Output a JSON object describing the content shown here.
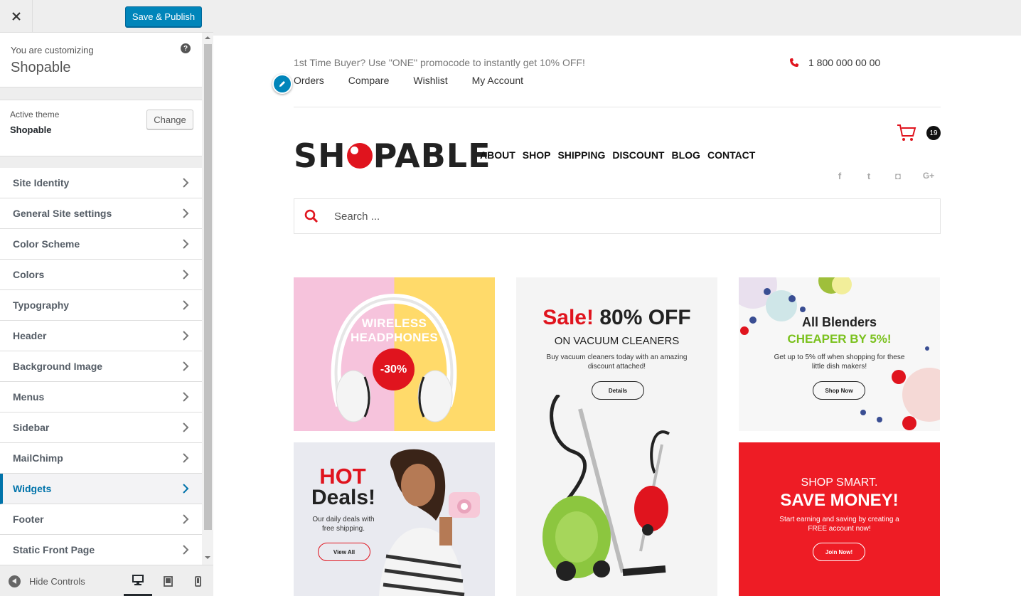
{
  "customizer": {
    "close_icon": "close-icon",
    "publish_label": "Save & Publish",
    "customizing_sub": "You are customizing",
    "site_name": "Shopable",
    "help_icon": "help-icon",
    "help_glyph": "?",
    "active_theme_label": "Active theme",
    "active_theme_name": "Shopable",
    "change_label": "Change",
    "panels": [
      {
        "label": "Site Identity"
      },
      {
        "label": "General Site settings"
      },
      {
        "label": "Color Scheme"
      },
      {
        "label": "Colors"
      },
      {
        "label": "Typography"
      },
      {
        "label": "Header"
      },
      {
        "label": "Background Image"
      },
      {
        "label": "Menus"
      },
      {
        "label": "Sidebar"
      },
      {
        "label": "MailChimp"
      },
      {
        "label": "Widgets",
        "active": true
      },
      {
        "label": "Footer"
      },
      {
        "label": "Static Front Page"
      }
    ],
    "hide_controls_label": "Hide Controls",
    "devices": [
      "desktop-icon",
      "tablet-icon",
      "mobile-icon"
    ],
    "accent_color": "#0085ba"
  },
  "site": {
    "promo_text": "1st Time Buyer? Use \"ONE\" promocode to instantly get 10% OFF!",
    "phone": "1 800 000 00 00",
    "top_links": [
      "Orders",
      "Compare",
      "Wishlist",
      "My Account"
    ],
    "logo_left": "SH",
    "logo_right": "PABLE",
    "nav": [
      "ABOUT",
      "SHOP",
      "SHIPPING",
      "DISCOUNT",
      "BLOG",
      "CONTACT"
    ],
    "cart_count": "19",
    "social": [
      "facebook-icon",
      "twitter-icon",
      "instagram-icon",
      "google-plus-icon"
    ],
    "social_glyphs": {
      "facebook": "f",
      "twitter": "t",
      "instagram": "◘",
      "google_plus": "G+"
    },
    "search_placeholder": "Search ...",
    "brand_color": "#e0141e"
  },
  "banners": {
    "headphones": {
      "title_line1": "WIRELESS",
      "title_line2": "HEADPHONES",
      "discount": "-30%"
    },
    "vacuum": {
      "sale_word": "Sale!",
      "sale_rest": "80% OFF",
      "subtitle": "ON VACUUM CLEANERS",
      "text": "Buy vacuum cleaners today with an amazing discount attached!",
      "button": "Details"
    },
    "blenders": {
      "title": "All Blenders",
      "highlight": "CHEAPER BY 5%!",
      "text": "Get up to 5% off when shopping for these little dish makers!",
      "button": "Shop Now"
    },
    "hot": {
      "word1": "HOT",
      "word2": "Deals!",
      "text": "Our daily deals with free shipping.",
      "button": "View All"
    },
    "smart": {
      "subtitle": "SHOP SMART.",
      "title": "SAVE MONEY!",
      "text": "Start earning and saving by creating a FREE account now!",
      "button": "Join Now!"
    }
  }
}
